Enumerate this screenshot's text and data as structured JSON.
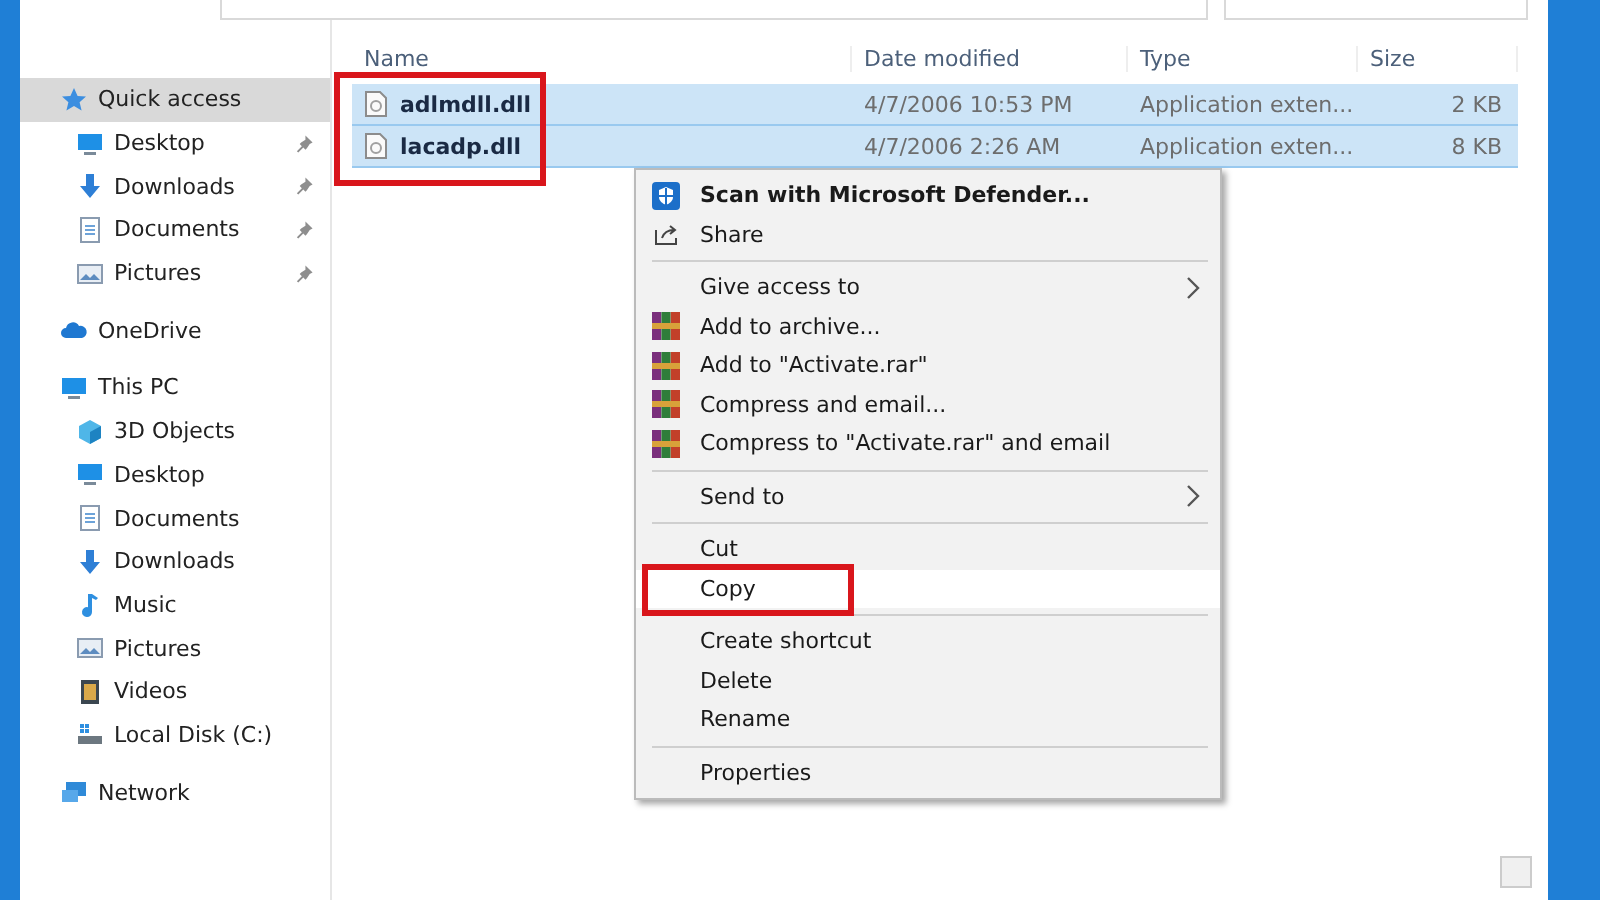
{
  "sidebar": {
    "items": [
      {
        "label": "Quick access",
        "selected": true,
        "children": [
          {
            "label": "Desktop",
            "pinned": true,
            "selected": false
          },
          {
            "label": "Downloads",
            "pinned": true,
            "selected": false
          },
          {
            "label": "Documents",
            "pinned": true,
            "selected": false
          },
          {
            "label": "Pictures",
            "pinned": true,
            "selected": false
          }
        ]
      },
      {
        "label": "OneDrive",
        "selected": false
      },
      {
        "label": "This PC",
        "selected": false,
        "children": [
          {
            "label": "3D Objects",
            "pinned": false,
            "selected": false
          },
          {
            "label": "Desktop",
            "pinned": false,
            "selected": false
          },
          {
            "label": "Documents",
            "pinned": false,
            "selected": false
          },
          {
            "label": "Downloads",
            "pinned": false,
            "selected": false
          },
          {
            "label": "Music",
            "pinned": false,
            "selected": false
          },
          {
            "label": "Pictures",
            "pinned": false,
            "selected": false
          },
          {
            "label": "Videos",
            "pinned": false,
            "selected": false
          },
          {
            "label": "Local Disk (C:)",
            "pinned": false,
            "selected": false
          }
        ]
      },
      {
        "label": "Network",
        "selected": false
      }
    ]
  },
  "file_list": {
    "columns": [
      "Name",
      "Date modified",
      "Type",
      "Size"
    ],
    "annotated": true,
    "rows": [
      {
        "name": "adlmdll.dll",
        "date": "4/7/2006 10:53 PM",
        "type": "Application exten...",
        "size": "2 KB",
        "selected": true
      },
      {
        "name": "lacadp.dll",
        "date": "4/7/2006 2:26 AM",
        "type": "Application exten...",
        "size": "8 KB",
        "selected": true
      }
    ]
  },
  "context_menu": {
    "items": [
      {
        "kind": "item",
        "label": "Scan with Microsoft Defender...",
        "default": true,
        "submenu": false,
        "highlighted": false,
        "annotated": false
      },
      {
        "kind": "item",
        "label": "Share",
        "default": false,
        "submenu": false,
        "highlighted": false,
        "annotated": false
      },
      {
        "kind": "separator"
      },
      {
        "kind": "item",
        "label": "Give access to",
        "default": false,
        "submenu": true,
        "highlighted": false,
        "annotated": false
      },
      {
        "kind": "item",
        "label": "Add to archive...",
        "default": false,
        "submenu": false,
        "highlighted": false,
        "annotated": false
      },
      {
        "kind": "item",
        "label": "Add to \"Activate.rar\"",
        "default": false,
        "submenu": false,
        "highlighted": false,
        "annotated": false
      },
      {
        "kind": "item",
        "label": "Compress and email...",
        "default": false,
        "submenu": false,
        "highlighted": false,
        "annotated": false
      },
      {
        "kind": "item",
        "label": "Compress to \"Activate.rar\" and email",
        "default": false,
        "submenu": false,
        "highlighted": false,
        "annotated": false
      },
      {
        "kind": "separator"
      },
      {
        "kind": "item",
        "label": "Send to",
        "default": false,
        "submenu": true,
        "highlighted": false,
        "annotated": false
      },
      {
        "kind": "separator"
      },
      {
        "kind": "item",
        "label": "Cut",
        "default": false,
        "submenu": false,
        "highlighted": false,
        "annotated": false
      },
      {
        "kind": "item",
        "label": "Copy",
        "default": false,
        "submenu": false,
        "highlighted": true,
        "annotated": true
      },
      {
        "kind": "separator"
      },
      {
        "kind": "item",
        "label": "Create shortcut",
        "default": false,
        "submenu": false,
        "highlighted": false,
        "annotated": false
      },
      {
        "kind": "item",
        "label": "Delete",
        "default": false,
        "submenu": false,
        "highlighted": false,
        "annotated": false
      },
      {
        "kind": "item",
        "label": "Rename",
        "default": false,
        "submenu": false,
        "highlighted": false,
        "annotated": false
      },
      {
        "kind": "separator"
      },
      {
        "kind": "item",
        "label": "Properties",
        "default": false,
        "submenu": false,
        "highlighted": false,
        "annotated": false
      }
    ]
  }
}
